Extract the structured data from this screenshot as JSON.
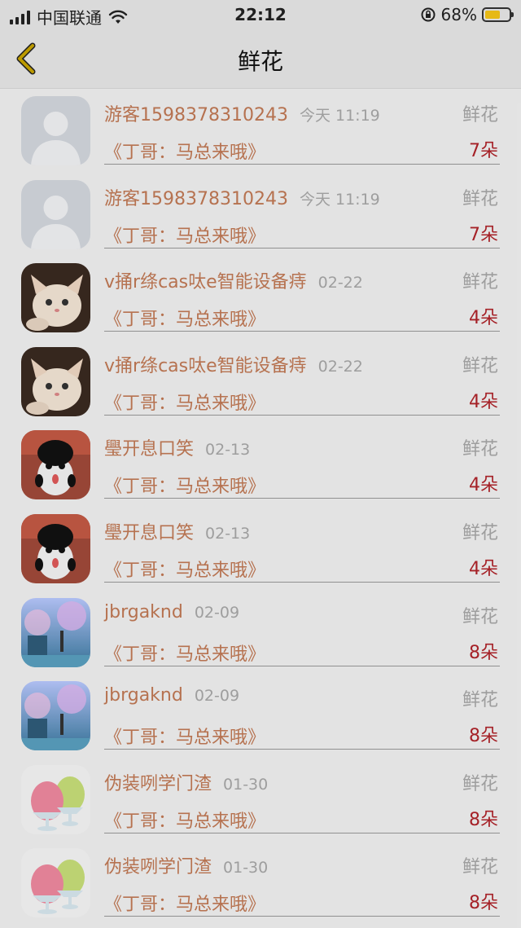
{
  "status_bar": {
    "carrier": "中国联通",
    "time": "22:12",
    "battery_percent": "68%",
    "battery_level": 0.68,
    "icons": [
      "signal-icon",
      "wifi-icon",
      "rotation-lock-icon",
      "battery-icon"
    ]
  },
  "nav": {
    "title": "鲜花",
    "back_icon": "chevron-left-icon",
    "accent": "#c8a400"
  },
  "colors": {
    "name_text": "#c27a55",
    "time_text": "#a8a8a8",
    "count_text": "#b0242a"
  },
  "items": [
    {
      "avatar": "default-avatar-icon",
      "name": "游客1598378310243",
      "time": "今天 11:19",
      "label": "鲜花",
      "subtitle": "《丁哥：马总来哦》",
      "count": "7朵"
    },
    {
      "avatar": "default-avatar-icon",
      "name": "游客1598378310243",
      "time": "今天 11:19",
      "label": "鲜花",
      "subtitle": "《丁哥：马总来哦》",
      "count": "7朵"
    },
    {
      "avatar": "kitten-avatar",
      "name": "v捅r绦cas呔e智能设备痔",
      "time": "02-22",
      "label": "鲜花",
      "subtitle": "《丁哥：马总来哦》",
      "count": "4朵"
    },
    {
      "avatar": "kitten-avatar",
      "name": "v捅r绦cas呔e智能设备痔",
      "time": "02-22",
      "label": "鲜花",
      "subtitle": "《丁哥：马总来哦》",
      "count": "4朵"
    },
    {
      "avatar": "panda-avatar",
      "name": "璺开息口笑",
      "time": "02-13",
      "label": "鲜花",
      "subtitle": "《丁哥：马总来哦》",
      "count": "4朵"
    },
    {
      "avatar": "panda-avatar",
      "name": "璺开息口笑",
      "time": "02-13",
      "label": "鲜花",
      "subtitle": "《丁哥：马总来哦》",
      "count": "4朵"
    },
    {
      "avatar": "anime-scene-avatar",
      "name": "jbrgaknd",
      "time": "02-09",
      "label": "鲜花",
      "subtitle": "《丁哥：马总来哦》",
      "count": "8朵"
    },
    {
      "avatar": "anime-scene-avatar",
      "name": "jbrgaknd",
      "time": "02-09",
      "label": "鲜花",
      "subtitle": "《丁哥：马总来哦》",
      "count": "8朵"
    },
    {
      "avatar": "shaved-ice-avatar",
      "name": "伪装咧学门渣",
      "time": "01-30",
      "label": "鲜花",
      "subtitle": "《丁哥：马总来哦》",
      "count": "8朵"
    },
    {
      "avatar": "shaved-ice-avatar",
      "name": "伪装咧学门渣",
      "time": "01-30",
      "label": "鲜花",
      "subtitle": "《丁哥：马总来哦》",
      "count": "8朵"
    }
  ]
}
